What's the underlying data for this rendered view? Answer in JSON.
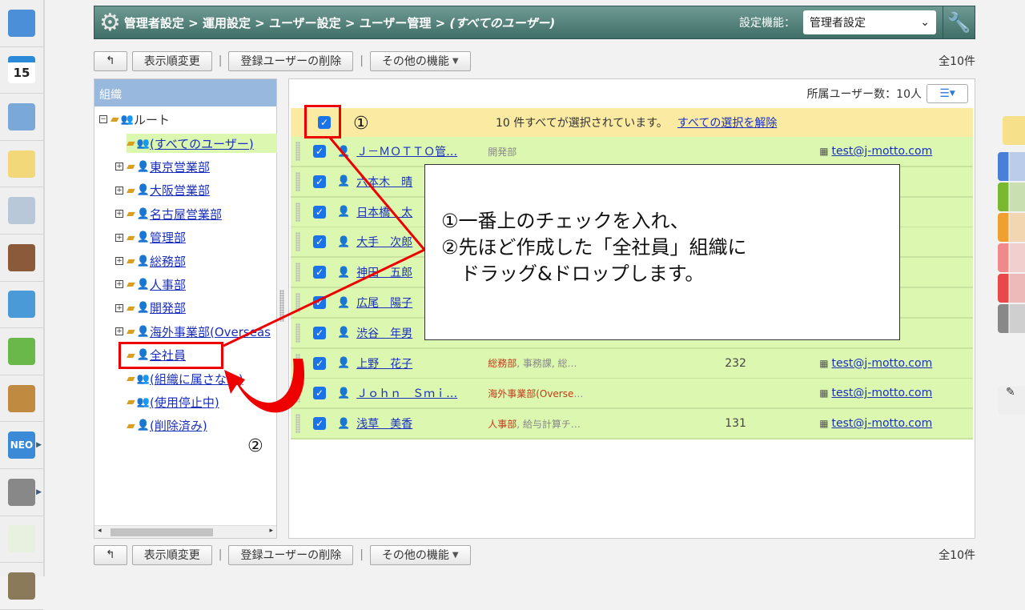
{
  "sidebar": {
    "items": [
      {
        "icon": "dashboard-icon",
        "color": "#4a8fd8"
      },
      {
        "icon": "calendar-icon",
        "label": "15",
        "color": "#2a8ad8"
      },
      {
        "icon": "presentation-icon",
        "color": "#7aa8d8"
      },
      {
        "icon": "memo-icon",
        "color": "#f2d878"
      },
      {
        "icon": "bulletin-board-icon",
        "color": "#b8c8d8"
      },
      {
        "icon": "clipboard-icon",
        "color": "#8a5a3a"
      },
      {
        "icon": "search-document-icon",
        "color": "#4a9ad8"
      },
      {
        "icon": "refresh-document-icon",
        "color": "#6ab84a"
      },
      {
        "icon": "binders-icon",
        "color": "#c08a40"
      },
      {
        "icon": "neo-icon",
        "label": "NEO",
        "color": "#3a8ad8"
      },
      {
        "icon": "folder-icon",
        "color": "#888888"
      },
      {
        "icon": "app-logo-icon",
        "color": "#e8f0e0"
      },
      {
        "icon": "banner-icon",
        "color": "#8a7a5a"
      }
    ]
  },
  "header": {
    "icon": "gear-icon",
    "breadcrumb": [
      "管理者設定",
      "運用設定",
      "ユーザー設定",
      "ユーザー管理"
    ],
    "breadcrumb_current": "(すべてのユーザー)",
    "separator": " > ",
    "settings_label": "設定機能：",
    "settings_value": "管理者設定",
    "tool_icon": "wrench-icon"
  },
  "toolbar": {
    "back_icon": "back-arrow-icon",
    "reorder": "表示順変更",
    "delete_users": "登録ユーザーの削除",
    "other_functions": "その他の機能",
    "dropdown_glyph": "▼",
    "total": "全10件"
  },
  "tree": {
    "header": "組織",
    "root": "ルート",
    "nodes": [
      {
        "label": "(すべてのユーザー)",
        "expandable": false,
        "selected": true
      },
      {
        "label": "東京営業部",
        "expandable": true
      },
      {
        "label": "大阪営業部",
        "expandable": true
      },
      {
        "label": "名古屋営業部",
        "expandable": true
      },
      {
        "label": "管理部",
        "expandable": true
      },
      {
        "label": "総務部",
        "expandable": true
      },
      {
        "label": "人事部",
        "expandable": true
      },
      {
        "label": "開発部",
        "expandable": true
      },
      {
        "label": "海外事業部(Overseas",
        "expandable": true
      },
      {
        "label": "全社員",
        "expandable": false
      },
      {
        "label": "(組織に属さない)",
        "expandable": false
      },
      {
        "label": "(使用停止中)",
        "expandable": false
      },
      {
        "label": "(削除済み)",
        "expandable": false
      }
    ]
  },
  "list": {
    "member_count": "所属ユーザー数：10人",
    "select_all_message": "10 件すべてが選択されています。",
    "clear_selection": "すべての選択を解除",
    "rows": [
      {
        "name": "Ｊ－ＭＯＴＴＯ管…",
        "dept_main": "",
        "dept_rest": "開発部",
        "num": "",
        "email": "test@j-motto.com"
      },
      {
        "name": "六本木　晴",
        "dept_main": "",
        "dept_rest": "",
        "num": "",
        "email": "o.com"
      },
      {
        "name": "日本橋　太",
        "dept_main": "",
        "dept_rest": "",
        "num": "",
        "email": "o.com"
      },
      {
        "name": "大手　次郎",
        "dept_main": "",
        "dept_rest": "",
        "num": "",
        "email": "o.com"
      },
      {
        "name": "神田　五郎",
        "dept_main": "",
        "dept_rest": "",
        "num": "",
        "email": "o.com"
      },
      {
        "name": "広尾　陽子",
        "dept_main": "",
        "dept_rest": "",
        "num": "",
        "email": "o.com"
      },
      {
        "name": "渋谷　年男",
        "dept_main": "",
        "dept_rest": "",
        "num": "",
        "email": "o.com"
      },
      {
        "name": "上野　花子",
        "dept_main": "総務部",
        "dept_rest": ", 事務課, 総…",
        "num": "232",
        "email": "test@j-motto.com"
      },
      {
        "name": "Ｊｏｈｎ　Ｓｍｉ…",
        "dept_main": "海外事業部(Overse",
        "dept_rest": "…",
        "num": "",
        "email": "test@j-motto.com"
      },
      {
        "name": "浅草　美香",
        "dept_main": "人事部",
        "dept_rest": ", 給与計算チ…",
        "num": "131",
        "email": "test@j-motto.com"
      }
    ]
  },
  "annotation": {
    "line1": "①一番上のチェックを入れ、",
    "line2": "②先ほど作成した「全社員」組織に",
    "line3": "　ドラッグ&ドロップします。",
    "marker1": "①",
    "marker2": "②",
    "color": "#e00000"
  },
  "right_strip": [
    "#4a7fd8",
    "#7ab830",
    "#f0a030",
    "#f08a8a",
    "#e84848",
    "#888888"
  ]
}
